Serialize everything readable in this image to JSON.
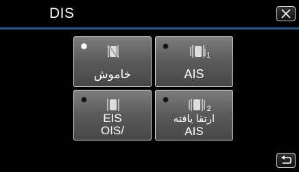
{
  "header": {
    "title": "DIS",
    "close_icon": "close-icon"
  },
  "options": [
    {
      "label": "خاموش",
      "selected": true,
      "icon": "stabilizer-off-icon"
    },
    {
      "label": "AIS",
      "selected": false,
      "icon": "ais-1-icon",
      "icon_sub": "1"
    },
    {
      "label_lines": [
        "EIS",
        "OIS/"
      ],
      "selected": false,
      "icon": "eis-ois-icon"
    },
    {
      "label_lines": [
        "ارتقا يافته",
        "AIS"
      ],
      "selected": false,
      "icon": "ais-2-icon",
      "icon_sub": "2"
    }
  ],
  "footer": {
    "back_icon": "return-icon"
  },
  "colors": {
    "header_line": "#2c5c85",
    "button_top": "#7d7d7d",
    "button_bottom": "#474747"
  }
}
